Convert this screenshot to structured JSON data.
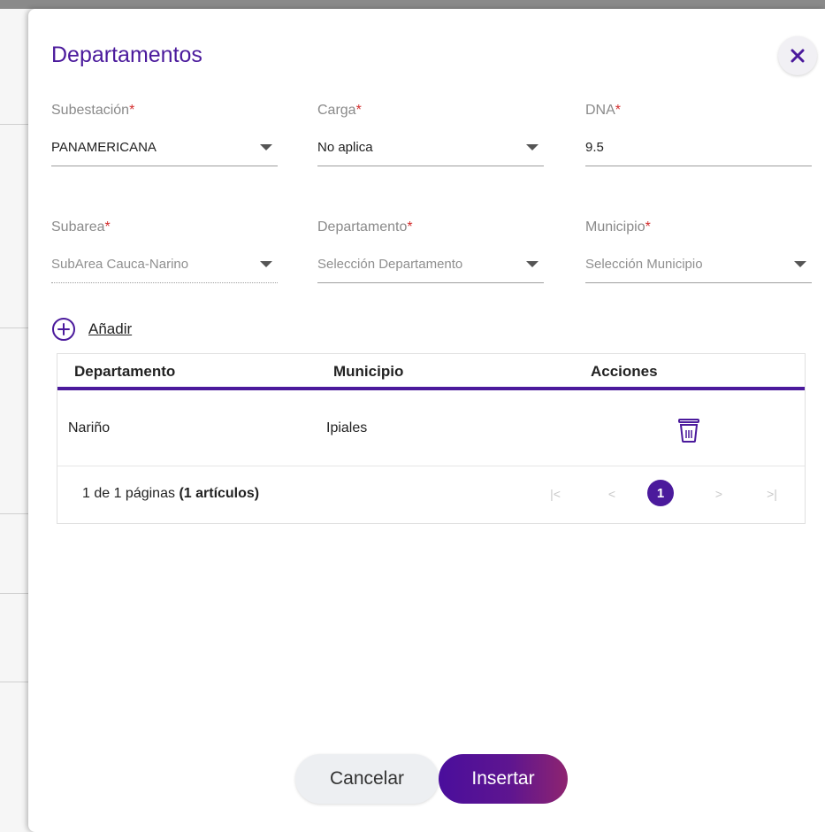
{
  "modal": {
    "title": "Departamentos",
    "close_icon": "close-icon"
  },
  "form": {
    "required_marker": "*",
    "subestacion": {
      "label": "Subestación",
      "value": "PANAMERICANA"
    },
    "carga": {
      "label": "Carga",
      "value": "No aplica"
    },
    "dna": {
      "label": "DNA",
      "value": "9.5"
    },
    "subarea": {
      "label": "Subarea",
      "value": "SubArea Cauca-Narino"
    },
    "departamento": {
      "label": "Departamento",
      "placeholder": "Selección Departamento"
    },
    "municipio": {
      "label": "Municipio",
      "placeholder": "Selección Municipio"
    }
  },
  "add": {
    "label": "Añadir",
    "icon": "plus-circle-icon"
  },
  "table": {
    "columns": [
      "Departamento",
      "Municipio",
      "Acciones"
    ],
    "rows": [
      {
        "departamento": "Nariño",
        "municipio": "Ipiales",
        "action_icon": "trash-icon"
      }
    ]
  },
  "pager": {
    "info_prefix": "1 de 1 páginas",
    "info_count": "(1 artículos)",
    "first": "|<",
    "prev": "<",
    "current": "1",
    "next": ">",
    "last": ">|"
  },
  "actions": {
    "cancel": "Cancelar",
    "insert": "Insertar"
  },
  "colors": {
    "accent": "#4b1a9c",
    "required": "#d32f2f"
  }
}
